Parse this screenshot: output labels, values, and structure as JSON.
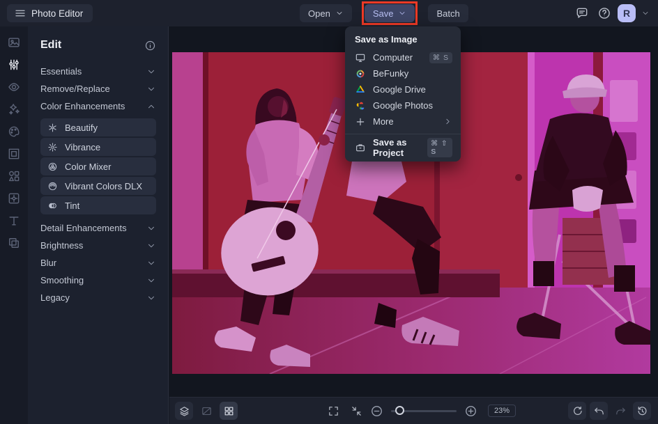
{
  "header": {
    "app_title": "Photo Editor",
    "open_button": "Open",
    "save_button": "Save",
    "batch_button": "Batch",
    "avatar_initial": "R"
  },
  "panel": {
    "title": "Edit",
    "sections": [
      {
        "label": "Essentials",
        "expanded": false
      },
      {
        "label": "Remove/Replace",
        "expanded": false
      },
      {
        "label": "Color Enhancements",
        "expanded": true
      },
      {
        "label": "Detail Enhancements",
        "expanded": false
      },
      {
        "label": "Brightness",
        "expanded": false
      },
      {
        "label": "Blur",
        "expanded": false
      },
      {
        "label": "Smoothing",
        "expanded": false
      },
      {
        "label": "Legacy",
        "expanded": false
      }
    ],
    "color_enhancement_items": [
      {
        "label": "Beautify",
        "icon": "beautify-icon"
      },
      {
        "label": "Vibrance",
        "icon": "vibrance-icon"
      },
      {
        "label": "Color Mixer",
        "icon": "color-mixer-icon"
      },
      {
        "label": "Vibrant Colors DLX",
        "icon": "vibrant-colors-dlx-icon"
      },
      {
        "label": "Tint",
        "icon": "tint-icon"
      }
    ]
  },
  "save_menu": {
    "title": "Save as Image",
    "items": [
      {
        "label": "Computer",
        "icon": "computer-icon",
        "shortcut": "⌘ S"
      },
      {
        "label": "BeFunky",
        "icon": "befunky-icon",
        "shortcut": ""
      },
      {
        "label": "Google Drive",
        "icon": "google-drive-icon",
        "shortcut": ""
      },
      {
        "label": "Google Photos",
        "icon": "google-photos-icon",
        "shortcut": ""
      },
      {
        "label": "More",
        "icon": "plus-icon",
        "has_submenu": true
      }
    ],
    "project_item": {
      "label": "Save as Project",
      "icon": "briefcase-icon",
      "shortcut": "⌘ ⇧ S"
    }
  },
  "footer": {
    "zoom_level": "23%"
  },
  "canvas": {
    "image_description": "Street photo of two seated musicians (one playing acoustic guitar, one on a folding stool wearing a cap) with a magenta duotone tint applied"
  },
  "colors": {
    "save_button_bg": "#3e4566",
    "annotation_highlight": "#ee3a26",
    "avatar_bg": "#b9bdf6",
    "magenta_tint": "#c22fb4",
    "crimson_tint": "#9c2038"
  }
}
